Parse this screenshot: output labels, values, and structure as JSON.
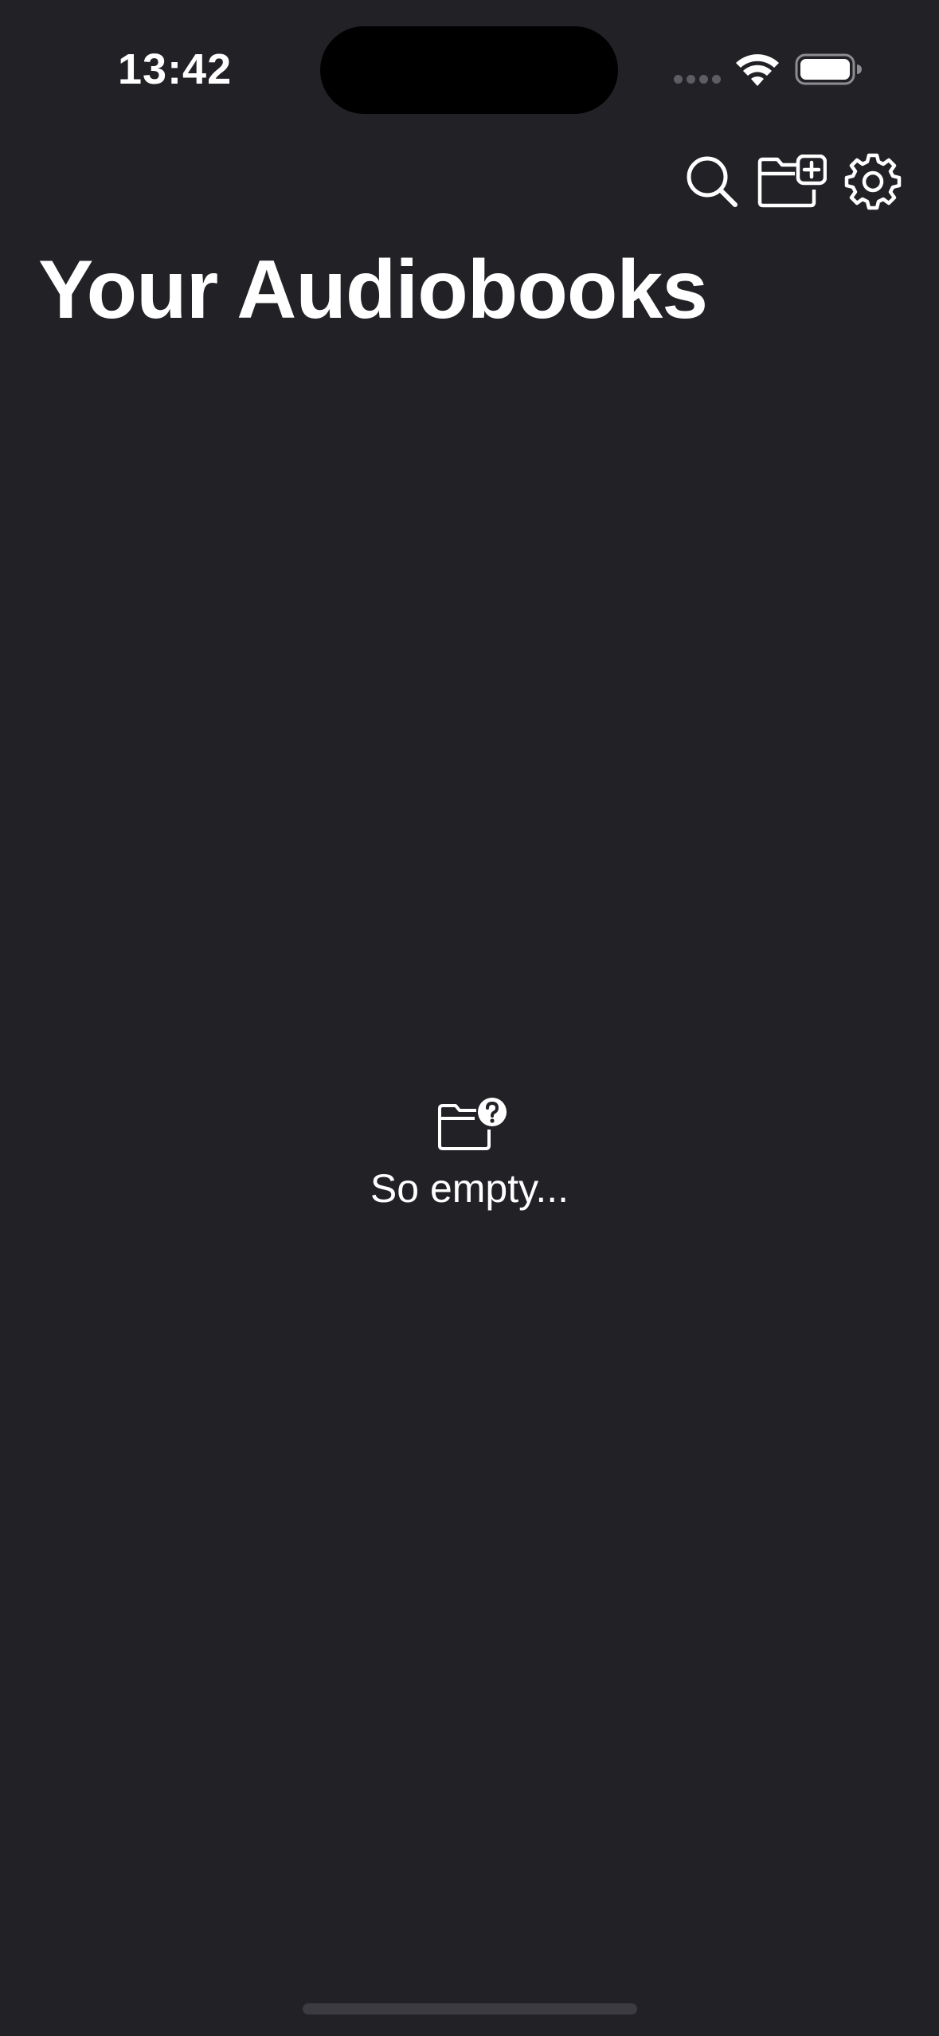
{
  "status_bar": {
    "time": "13:42",
    "icons": [
      "signal-dots-icon",
      "wifi-icon",
      "battery-icon"
    ]
  },
  "toolbar": {
    "buttons": [
      {
        "icon": "search-icon"
      },
      {
        "icon": "folder-plus-icon"
      },
      {
        "icon": "gear-icon"
      }
    ]
  },
  "header": {
    "title": "Your Audiobooks"
  },
  "empty_state": {
    "icon": "folder-question-icon",
    "message": "So empty..."
  },
  "colors": {
    "background": "#222126",
    "foreground": "#ffffff",
    "island": "#000000",
    "home_indicator": "#3c3b41"
  }
}
